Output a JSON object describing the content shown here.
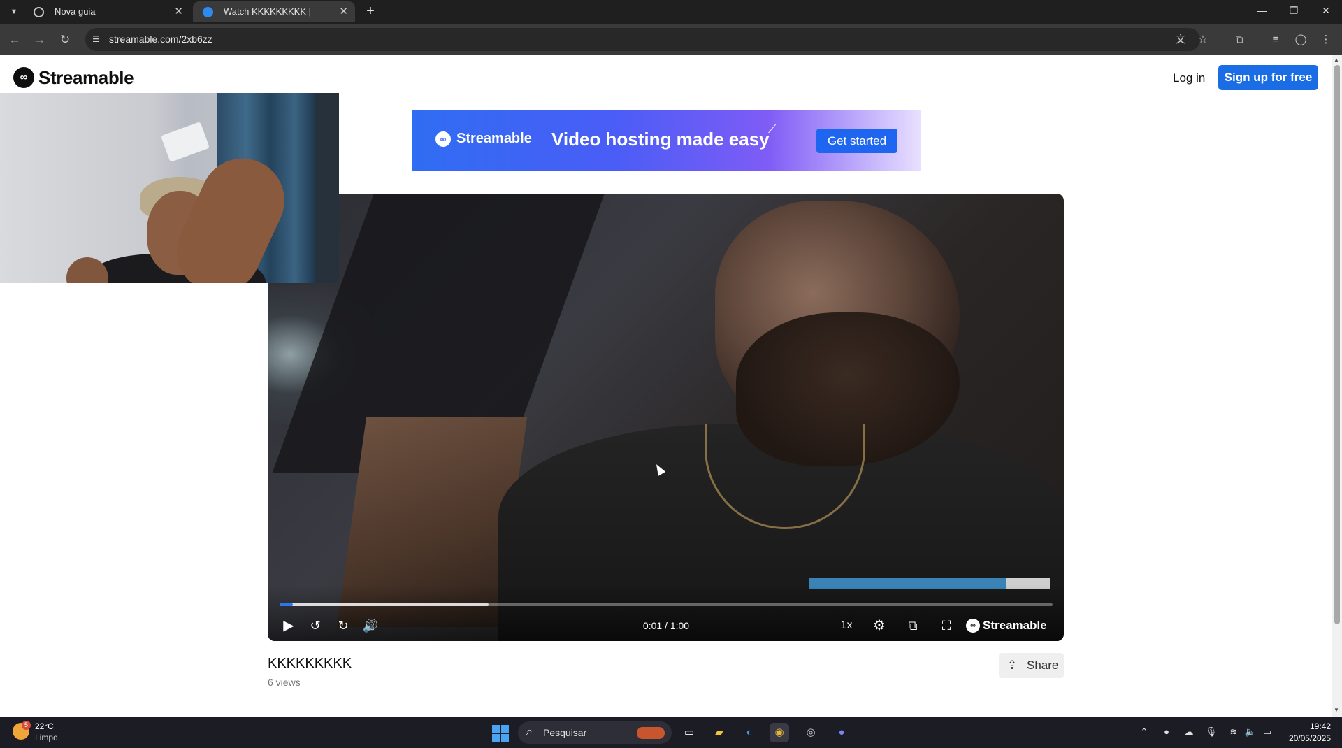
{
  "browser": {
    "tabs": [
      {
        "title": "Nova guia",
        "active": false
      },
      {
        "title": "Watch KKKKKKKKK | Streamable",
        "active": true
      }
    ],
    "url": "streamable.com/2xb6zz"
  },
  "site": {
    "logo_text": "Streamable",
    "login_label": "Log in",
    "signup_label": "Sign up for free"
  },
  "banner": {
    "logo_text": "Streamable",
    "headline": "Video hosting made easy",
    "cta_label": "Get started"
  },
  "player": {
    "progress_played": 0.017,
    "progress_buffered": 0.27,
    "time_display": "0:01 / 1:00",
    "speed_label": "1x",
    "brand_label": "Streamable"
  },
  "video": {
    "title": "KKKKKKKKK",
    "views": "6 views",
    "share_label": "Share"
  },
  "taskbar": {
    "weather_temp": "22°C",
    "weather_condition": "Limpo",
    "weather_badge": "5",
    "search_placeholder": "Pesquisar",
    "time": "19:42",
    "date": "20/05/2025"
  },
  "colors": {
    "accent": "#1b6de5",
    "progress": "#2d74f0"
  }
}
